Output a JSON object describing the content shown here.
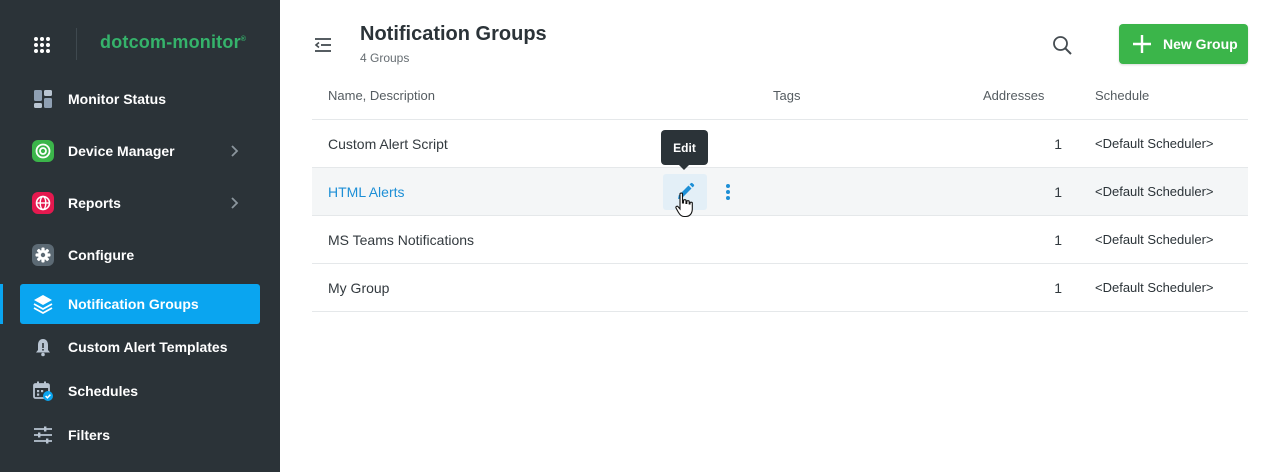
{
  "brand": {
    "logo_text": "dotcom-monitor",
    "logo_mark": "®"
  },
  "sidebar": {
    "items": [
      {
        "label": "Monitor Status",
        "icon": "dashboard-icon"
      },
      {
        "label": "Device Manager",
        "icon": "target-icon",
        "has_submenu": true
      },
      {
        "label": "Reports",
        "icon": "globe-icon",
        "has_submenu": true
      },
      {
        "label": "Configure",
        "icon": "gear-icon"
      },
      {
        "label": "Notification Groups",
        "icon": "layers-icon",
        "active": true
      },
      {
        "label": "Custom Alert Templates",
        "icon": "bell-icon"
      },
      {
        "label": "Schedules",
        "icon": "calendar-icon"
      },
      {
        "label": "Filters",
        "icon": "sliders-icon"
      }
    ]
  },
  "header": {
    "title": "Notification Groups",
    "subtitle": "4 Groups",
    "new_group_label": "New Group"
  },
  "table": {
    "columns": [
      "Name, Description",
      "Tags",
      "Addresses",
      "Schedule"
    ],
    "rows": [
      {
        "name": "Custom Alert Script",
        "tags": "",
        "addresses": "1",
        "schedule": "<Default Scheduler>"
      },
      {
        "name": "HTML Alerts",
        "tags": "",
        "addresses": "1",
        "schedule": "<Default Scheduler>",
        "hovered": true
      },
      {
        "name": "MS Teams Notifications",
        "tags": "",
        "addresses": "1",
        "schedule": "<Default Scheduler>"
      },
      {
        "name": "My Group",
        "tags": "",
        "addresses": "1",
        "schedule": "<Default Scheduler>"
      }
    ]
  },
  "tooltip": {
    "text": "Edit"
  },
  "colors": {
    "sidebar_bg": "#2b3338",
    "active_item": "#0aa5f0",
    "primary_button": "#3bb54a",
    "link": "#1d8fd6",
    "logo": "#35b36b"
  }
}
